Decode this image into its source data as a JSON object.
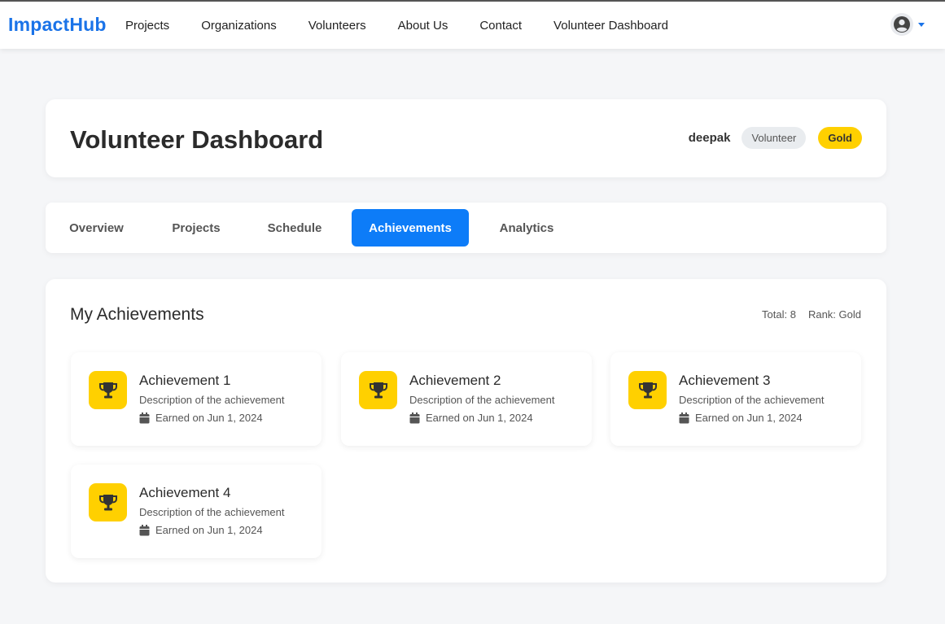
{
  "brand": "ImpactHub",
  "nav": [
    {
      "label": "Projects"
    },
    {
      "label": "Organizations"
    },
    {
      "label": "Volunteers"
    },
    {
      "label": "About Us"
    },
    {
      "label": "Contact"
    },
    {
      "label": "Volunteer Dashboard"
    }
  ],
  "user_menu": {
    "icon": "user-circle-icon",
    "caret": "caret-down-icon"
  },
  "header": {
    "title": "Volunteer Dashboard",
    "username": "deepak",
    "role_badge": "Volunteer",
    "rank_badge": "Gold"
  },
  "tabs": [
    {
      "label": "Overview",
      "active": false
    },
    {
      "label": "Projects",
      "active": false
    },
    {
      "label": "Schedule",
      "active": false
    },
    {
      "label": "Achievements",
      "active": true
    },
    {
      "label": "Analytics",
      "active": false
    }
  ],
  "achievements": {
    "title": "My Achievements",
    "total": "Total: 8",
    "rank": "Rank: Gold",
    "items": [
      {
        "title": "Achievement 1",
        "description": "Description of the achievement",
        "date": "Earned on Jun 1, 2024",
        "icon": "trophy-icon"
      },
      {
        "title": "Achievement 2",
        "description": "Description of the achievement",
        "date": "Earned on Jun 1, 2024",
        "icon": "trophy-icon"
      },
      {
        "title": "Achievement 3",
        "description": "Description of the achievement",
        "date": "Earned on Jun 1, 2024",
        "icon": "trophy-icon"
      },
      {
        "title": "Achievement 4",
        "description": "Description of the achievement",
        "date": "Earned on Jun 1, 2024",
        "icon": "trophy-icon"
      }
    ]
  },
  "colors": {
    "brand": "#1a73e8",
    "active_tab": "#0d7cf8",
    "gold": "#ffd000",
    "background": "#f5f6f8"
  }
}
